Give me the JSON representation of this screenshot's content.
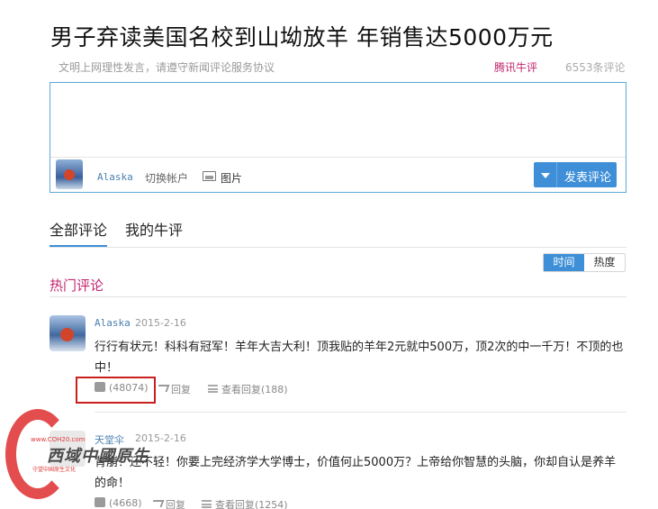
{
  "article": {
    "title": "男子弃读美国名校到山坳放羊 年销售达5000万元"
  },
  "notice": {
    "text": "文明上网理性发言，请遵守新闻评论服务协议",
    "brand": "腾讯牛评",
    "count": "6553条评论"
  },
  "editor": {
    "placeholder": "",
    "user": "Alaska",
    "switch_account": "切换帐户",
    "picture": "图片",
    "submit": "发表评论"
  },
  "tabs": [
    {
      "label": "全部评论",
      "active": true
    },
    {
      "label": "我的牛评",
      "active": false
    }
  ],
  "sort": {
    "time": "时间",
    "hot": "热度",
    "selected": "时间"
  },
  "section_title": "热门评论",
  "comments": [
    {
      "user": "Alaska",
      "date": "2015-2-16",
      "text": "行行有状元！科科有冠军！羊年大吉大利！顶我贴的羊年2元就中500万，顶2次的中一千万！不顶的也中！",
      "likes": "(48074)",
      "reply": "回复",
      "view_replies": "查看回复",
      "reply_count": "(188)"
    },
    {
      "user": "天堂伞",
      "date": "2015-2-16",
      "text": "背崩！还不轻！你要上完经济学大学博士，价值何止5000万？上帝给你智慧的头脑，你却自认是养羊的命！",
      "likes": "(4668)",
      "reply": "回复",
      "view_replies": "查看回复",
      "reply_count": "(1254)"
    }
  ],
  "watermark": {
    "url": "www.COH20.com",
    "text": "西域中國原生",
    "slogan": "守望中国原生文化"
  },
  "colors": {
    "accent": "#3e8fd8",
    "brand": "#c3256f",
    "highlight_border": "#c8201e"
  }
}
